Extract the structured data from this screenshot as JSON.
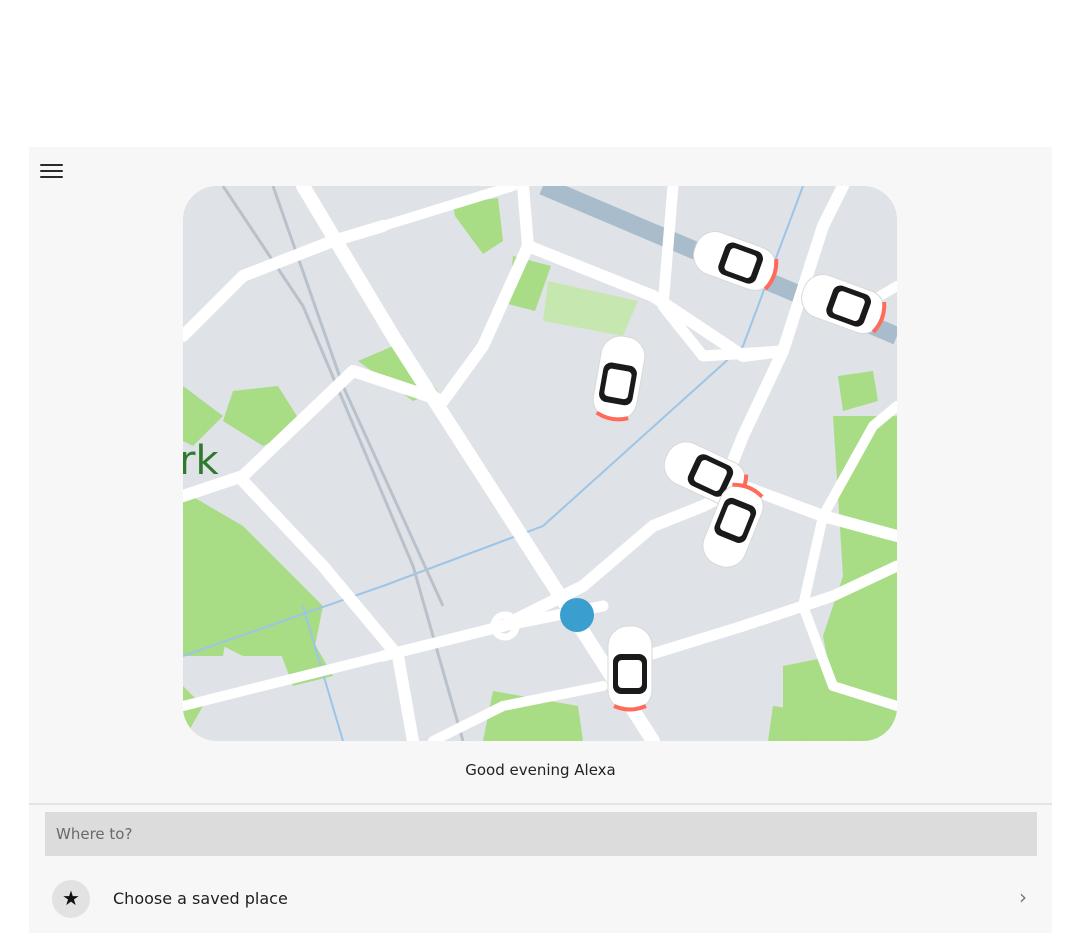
{
  "header": {
    "menu_icon": "hamburger-menu-icon"
  },
  "map": {
    "place_label": "rk",
    "road_color": "#ffffff",
    "land_color": "#dfe2e6",
    "park_color": "#a8dc85",
    "water_color": "#9cc5e8",
    "user_location_color": "#3a9fcf"
  },
  "greeting": "Good evening Alexa",
  "search": {
    "placeholder": "Where to?"
  },
  "saved_place": {
    "icon": "star-icon",
    "label": "Choose a saved place",
    "chevron": "›"
  }
}
